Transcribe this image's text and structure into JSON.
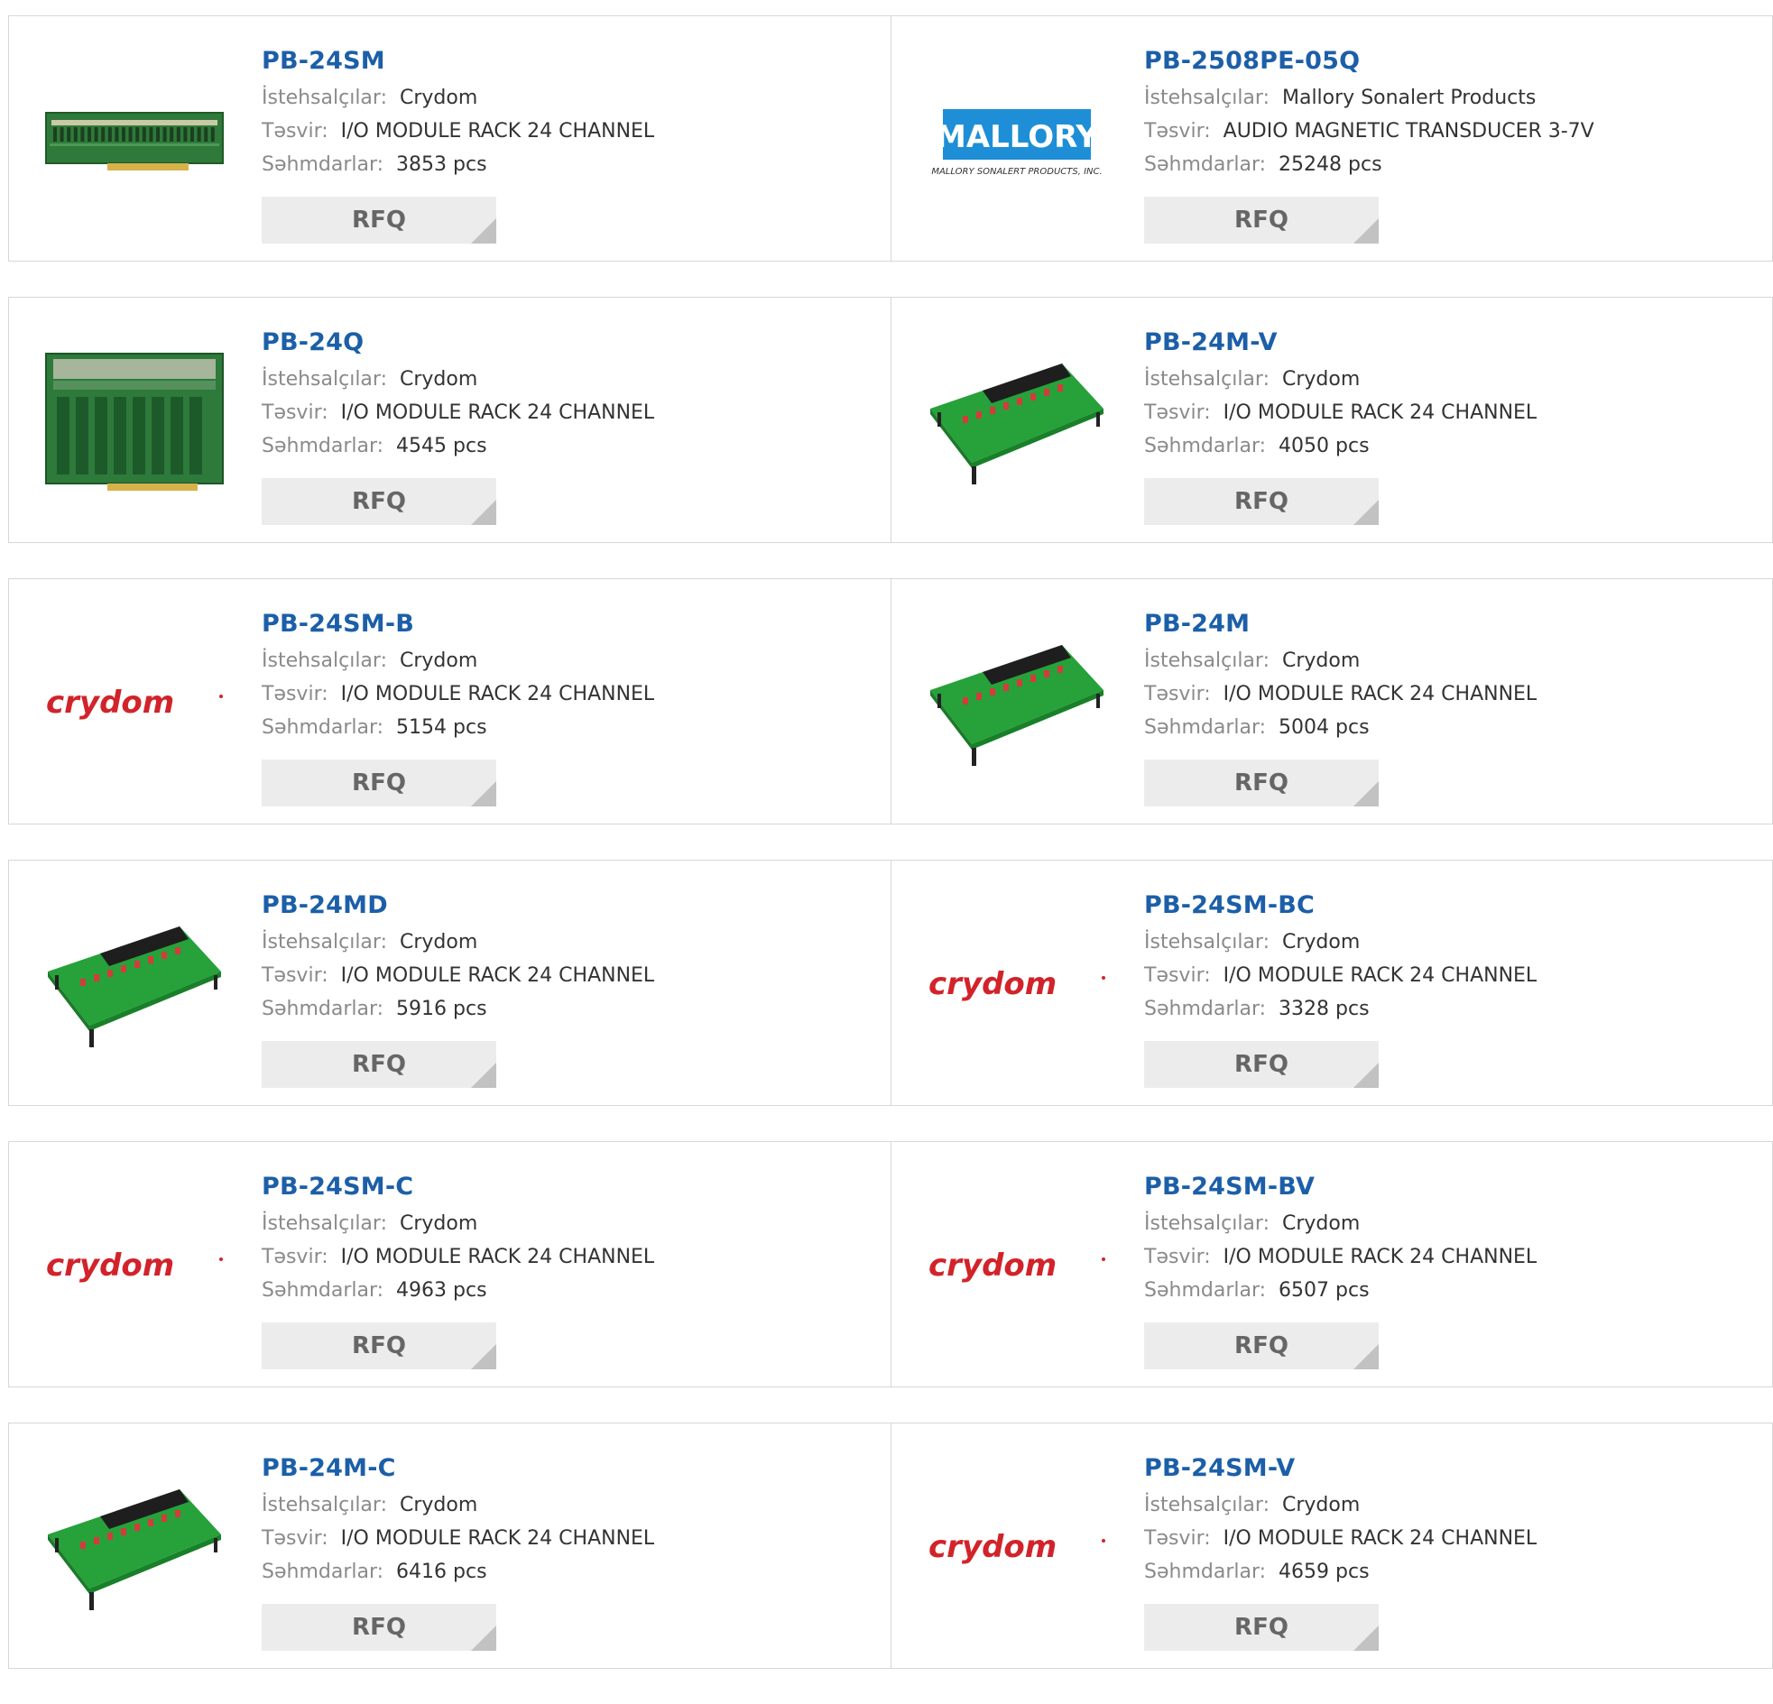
{
  "labels": {
    "manufacturer": "İstehsalçılar:",
    "description": "Təsvir:",
    "stock": "Səhmdarlar:",
    "rfq": "RFQ"
  },
  "colors": {
    "part_link": "#1c5fa8",
    "label": "#8a8a8a",
    "value": "#333333",
    "rfq_bg": "#ececec",
    "border": "#d7d7d7",
    "crydom_logo": "#d2232a",
    "mallory_logo": "#1e8fd6"
  },
  "brand_logos": {
    "crydom": "crydom",
    "mallory_main": "MALLORY",
    "mallory_sub": "MALLORY SONALERT PRODUCTS, INC."
  },
  "products": [
    {
      "part": "PB-24SM",
      "manufacturer": "Crydom",
      "description": "I/O MODULE RACK 24 CHANNEL",
      "stock": "3853 pcs",
      "image": "flat-board-image"
    },
    {
      "part": "PB-2508PE-05Q",
      "manufacturer": "Mallory Sonalert Products",
      "description": "AUDIO MAGNETIC TRANSDUCER 3-7V",
      "stock": "25248 pcs",
      "image": "mallory-logo"
    },
    {
      "part": "PB-24Q",
      "manufacturer": "Crydom",
      "description": "I/O MODULE RACK 24 CHANNEL",
      "stock": "4545 pcs",
      "image": "square-board-image"
    },
    {
      "part": "PB-24M-V",
      "manufacturer": "Crydom",
      "description": "I/O MODULE RACK 24 CHANNEL",
      "stock": "4050 pcs",
      "image": "angled-board-image"
    },
    {
      "part": "PB-24SM-B",
      "manufacturer": "Crydom",
      "description": "I/O MODULE RACK 24 CHANNEL",
      "stock": "5154 pcs",
      "image": "crydom-logo"
    },
    {
      "part": "PB-24M",
      "manufacturer": "Crydom",
      "description": "I/O MODULE RACK 24 CHANNEL",
      "stock": "5004 pcs",
      "image": "angled-board-image"
    },
    {
      "part": "PB-24MD",
      "manufacturer": "Crydom",
      "description": "I/O MODULE RACK 24 CHANNEL",
      "stock": "5916 pcs",
      "image": "angled-board-image"
    },
    {
      "part": "PB-24SM-BC",
      "manufacturer": "Crydom",
      "description": "I/O MODULE RACK 24 CHANNEL",
      "stock": "3328 pcs",
      "image": "crydom-logo"
    },
    {
      "part": "PB-24SM-C",
      "manufacturer": "Crydom",
      "description": "I/O MODULE RACK 24 CHANNEL",
      "stock": "4963 pcs",
      "image": "crydom-logo"
    },
    {
      "part": "PB-24SM-BV",
      "manufacturer": "Crydom",
      "description": "I/O MODULE RACK 24 CHANNEL",
      "stock": "6507 pcs",
      "image": "crydom-logo"
    },
    {
      "part": "PB-24M-C",
      "manufacturer": "Crydom",
      "description": "I/O MODULE RACK 24 CHANNEL",
      "stock": "6416 pcs",
      "image": "angled-board-image"
    },
    {
      "part": "PB-24SM-V",
      "manufacturer": "Crydom",
      "description": "I/O MODULE RACK 24 CHANNEL",
      "stock": "4659 pcs",
      "image": "crydom-logo"
    }
  ]
}
